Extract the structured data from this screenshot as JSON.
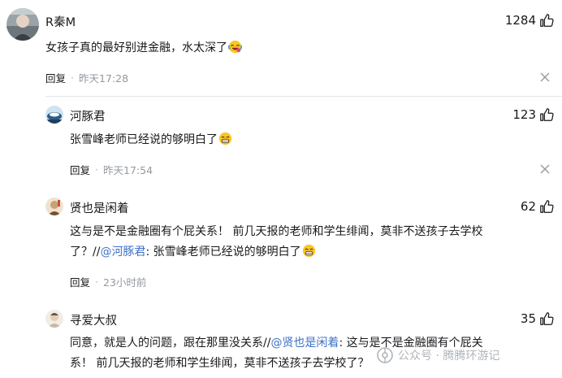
{
  "comments": [
    {
      "username": "R秦M",
      "likes": "1284",
      "text": "女孩子真的最好别进金融，水太深了",
      "emoji": "laughing-crying",
      "reply_label": "回复",
      "time": "昨天17:28"
    },
    {
      "username": "河豚君",
      "likes": "123",
      "text": "张雪峰老师已经说的够明白了",
      "emoji": "grin",
      "reply_label": "回复",
      "time": "昨天17:54"
    },
    {
      "username": "贤也是闲着",
      "likes": "62",
      "text_line1": "这与是不是金融圈有个屁关系！ 前几天报的老师和学生绯闻，莫非不送孩子去学校",
      "text_line2_pre": "了？//",
      "mention": "@河豚君",
      "text_line2_post": ":  张雪峰老师已经说的够明白了",
      "emoji": "grin",
      "reply_label": "回复",
      "time": "23小时前"
    },
    {
      "username": "寻爱大叔",
      "likes": "35",
      "text_line1_pre": "同意，就是人的问题，跟在那里没关系//",
      "mention": "@贤也是闲着",
      "text_line1_post": ": 这与是不是金融圈有个屁关",
      "text_line2": "系！ 前几天报的老师和学生绯闻，莫非不送孩子去学校了？"
    }
  ],
  "watermark": {
    "label": "公众号 · 腾腾环游记"
  },
  "colors": {
    "mention": "#3e70c8",
    "meta_gray": "#9499a0",
    "separator": "#e3e5e7"
  }
}
